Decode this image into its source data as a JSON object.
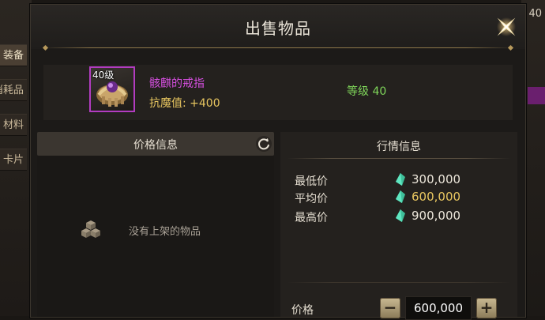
{
  "background": {
    "left_tabs": [
      "装备",
      "消耗品",
      "材料",
      "卡片"
    ],
    "right_text": "40"
  },
  "dialog": {
    "title": "出售物品",
    "close_icon": "close-x-star-icon"
  },
  "item": {
    "level_badge": "40级",
    "name": "骸麒的戒指",
    "stat": "抗魔值: +400",
    "required_level": "等级 40",
    "rarity_color": "#b23cc0"
  },
  "price_info": {
    "header": "价格信息",
    "refresh_icon": "refresh-icon",
    "empty_icon": "cube-stack-icon",
    "empty_text": "没有上架的物品"
  },
  "market_info": {
    "header": "行情信息",
    "rows": [
      {
        "label": "最低价",
        "value": "300,000"
      },
      {
        "label": "平均价",
        "value": "600,000"
      },
      {
        "label": "最高价",
        "value": "900,000"
      }
    ],
    "currency_icon": "green-crystal-icon"
  },
  "bid": {
    "label": "价格",
    "value": "600,000",
    "minus": "−",
    "plus": "+"
  }
}
